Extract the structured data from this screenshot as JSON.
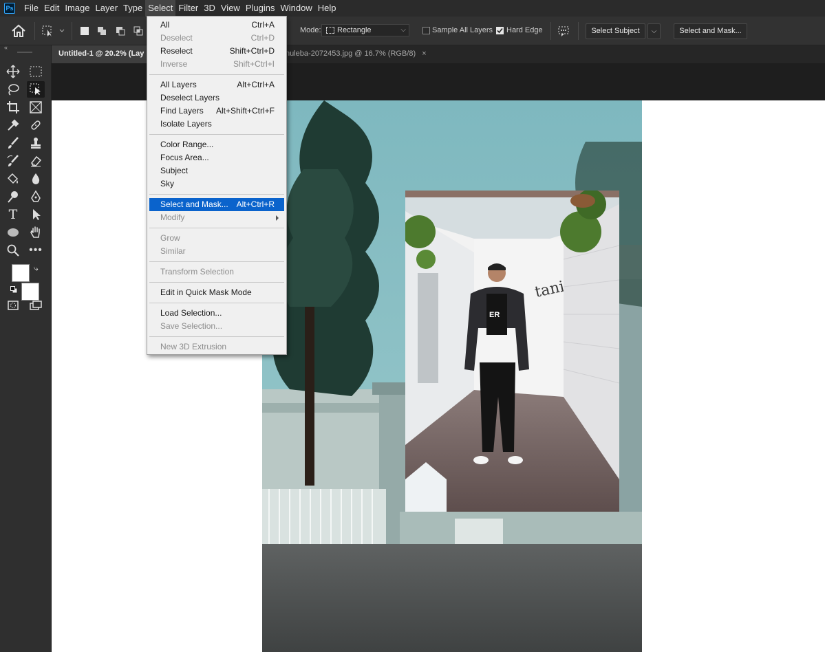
{
  "app": {
    "logo": "Ps"
  },
  "menubar": {
    "items": [
      "File",
      "Edit",
      "Image",
      "Layer",
      "Type",
      "Select",
      "Filter",
      "3D",
      "View",
      "Plugins",
      "Window",
      "Help"
    ],
    "active": "Select"
  },
  "options": {
    "mode_label": "Mode:",
    "mode_value": "Rectangle",
    "sample_all_layers": "Sample All Layers",
    "sample_all_layers_checked": false,
    "hard_edge": "Hard Edge",
    "hard_edge_checked": true,
    "select_subject": "Select Subject",
    "select_and_mask": "Select and Mask..."
  },
  "tabs": [
    {
      "label": "Untitled-1 @ 20.2% (Lay",
      "active": true
    },
    {
      "label": "nuleba-2072453.jpg @ 16.7% (RGB/8)",
      "active": false,
      "close": "×"
    }
  ],
  "select_menu": {
    "items": [
      {
        "label": "All",
        "shortcut": "Ctrl+A",
        "disabled": false
      },
      {
        "label": "Deselect",
        "shortcut": "Ctrl+D",
        "disabled": true
      },
      {
        "label": "Reselect",
        "shortcut": "Shift+Ctrl+D",
        "disabled": false
      },
      {
        "label": "Inverse",
        "shortcut": "Shift+Ctrl+I",
        "disabled": true
      },
      {
        "label": "All Layers",
        "shortcut": "Alt+Ctrl+A",
        "disabled": false
      },
      {
        "label": "Deselect Layers",
        "shortcut": "",
        "disabled": false
      },
      {
        "label": "Find Layers",
        "shortcut": "Alt+Shift+Ctrl+F",
        "disabled": false
      },
      {
        "label": "Isolate Layers",
        "shortcut": "",
        "disabled": false
      },
      {
        "label": "Color Range...",
        "shortcut": "",
        "disabled": false
      },
      {
        "label": "Focus Area...",
        "shortcut": "",
        "disabled": false
      },
      {
        "label": "Subject",
        "shortcut": "",
        "disabled": false
      },
      {
        "label": "Sky",
        "shortcut": "",
        "disabled": false
      },
      {
        "label": "Select and Mask...",
        "shortcut": "Alt+Ctrl+R",
        "disabled": false,
        "highlighted": true
      },
      {
        "label": "Modify",
        "shortcut": "",
        "disabled": true,
        "submenu": true
      },
      {
        "label": "Grow",
        "shortcut": "",
        "disabled": true
      },
      {
        "label": "Similar",
        "shortcut": "",
        "disabled": true
      },
      {
        "label": "Transform Selection",
        "shortcut": "",
        "disabled": true
      },
      {
        "label": "Edit in Quick Mask Mode",
        "shortcut": "",
        "disabled": false
      },
      {
        "label": "Load Selection...",
        "shortcut": "",
        "disabled": false
      },
      {
        "label": "Save Selection...",
        "shortcut": "",
        "disabled": true
      },
      {
        "label": "New 3D Extrusion",
        "shortcut": "",
        "disabled": true
      }
    ]
  },
  "tools": [
    "move-tool",
    "marquee-tool",
    "lasso-tool",
    "object-selection-tool",
    "crop-tool",
    "frame-tool",
    "eyedropper-tool",
    "healing-brush-tool",
    "brush-tool",
    "clone-stamp-tool",
    "history-brush-tool",
    "eraser-tool",
    "paint-bucket-tool",
    "blur-tool",
    "dodge-tool",
    "pen-tool",
    "type-tool",
    "path-selection-tool",
    "ellipse-tool",
    "hand-tool",
    "zoom-tool",
    "more-tools"
  ],
  "colors": {
    "foreground": "#ffffff",
    "background": "#ffffff",
    "highlight": "#0a63cc"
  }
}
